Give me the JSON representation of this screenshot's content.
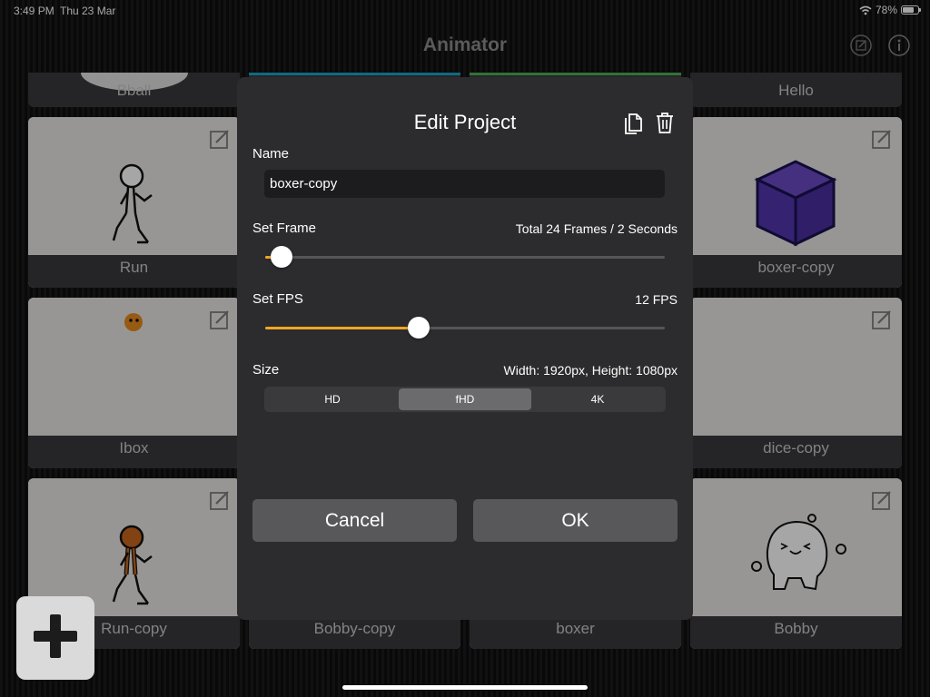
{
  "status_bar": {
    "time": "3:49 PM",
    "date": "Thu 23 Mar",
    "battery": "78%",
    "battery_level": 0.78
  },
  "nav": {
    "title": "Animator",
    "edit_icon": "square-pencil-icon",
    "info_icon": "info-circle-icon"
  },
  "top_row": [
    {
      "label": "Bball"
    },
    {
      "label": ""
    },
    {
      "label": ""
    },
    {
      "label": "Hello"
    }
  ],
  "projects": {
    "run": {
      "label": "Run"
    },
    "boxer_copy": {
      "label": "boxer-copy"
    },
    "ibox": {
      "label": "Ibox"
    },
    "dice_copy": {
      "label": "dice-copy"
    },
    "run_copy": {
      "label": "Run-copy"
    },
    "bobby_copy": {
      "label": "Bobby-copy"
    },
    "boxer": {
      "label": "boxer"
    },
    "bobby": {
      "label": "Bobby"
    }
  },
  "modal": {
    "title": "Edit Project",
    "name_label": "Name",
    "name_value": "boxer-copy",
    "frame_label": "Set Frame",
    "frame_value": "Total 24 Frames / 2 Seconds",
    "frame_slider_fraction": 0.04,
    "fps_label": "Set FPS",
    "fps_value": "12 FPS",
    "fps_slider_fraction": 0.385,
    "size_label": "Size",
    "size_value": "Width: 1920px, Height: 1080px",
    "size_options": [
      "HD",
      "fHD",
      "4K"
    ],
    "size_selected": "fHD",
    "cancel_label": "Cancel",
    "ok_label": "OK"
  },
  "colors": {
    "accent": "#f5a623",
    "modal_bg": "#2c2c2e",
    "button_bg": "#58585b"
  }
}
